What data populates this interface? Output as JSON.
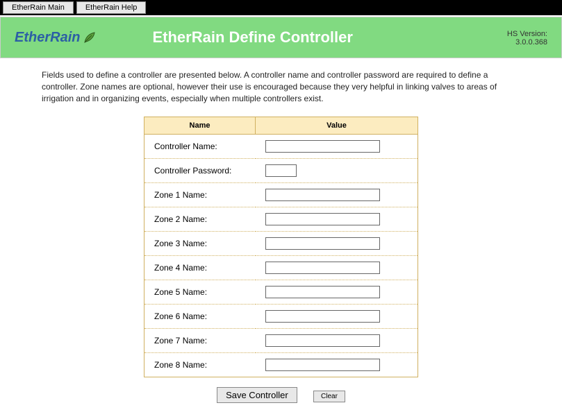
{
  "topbar": {
    "main_label": "EtherRain Main",
    "help_label": "EtherRain Help"
  },
  "header": {
    "logo_text": "EtherRain",
    "page_title": "EtherRain Define Controller",
    "version_label": "HS Version:",
    "version_value": "3.0.0.368"
  },
  "description": "Fields used to define a controller are presented below. A controller name and controller password are required to define a controller. Zone names are optional, however their use is encouraged because they very helpful in linking valves to areas of irrigation and in organizing events, especially when multiple controllers exist.",
  "table": {
    "col_name": "Name",
    "col_value": "Value",
    "rows": [
      {
        "label": "Controller Name:",
        "value": "",
        "short": false
      },
      {
        "label": "Controller Password:",
        "value": "",
        "short": true
      },
      {
        "label": "Zone 1 Name:",
        "value": "",
        "short": false
      },
      {
        "label": "Zone 2 Name:",
        "value": "",
        "short": false
      },
      {
        "label": "Zone 3 Name:",
        "value": "",
        "short": false
      },
      {
        "label": "Zone 4 Name:",
        "value": "",
        "short": false
      },
      {
        "label": "Zone 5 Name:",
        "value": "",
        "short": false
      },
      {
        "label": "Zone 6 Name:",
        "value": "",
        "short": false
      },
      {
        "label": "Zone 7 Name:",
        "value": "",
        "short": false
      },
      {
        "label": "Zone 8 Name:",
        "value": "",
        "short": false
      }
    ]
  },
  "buttons": {
    "save": "Save Controller",
    "clear": "Clear"
  }
}
